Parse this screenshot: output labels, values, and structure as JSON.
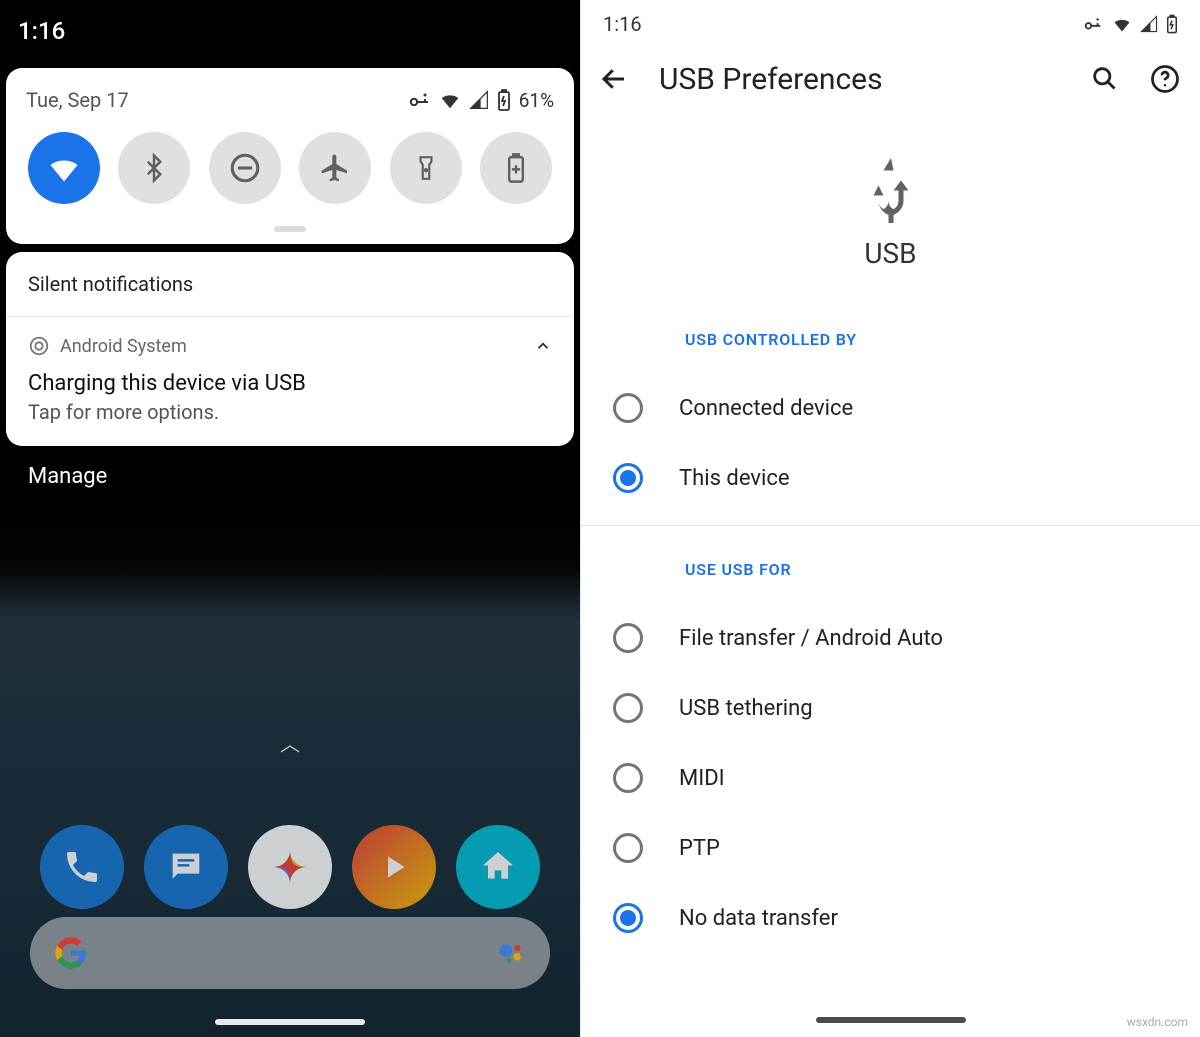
{
  "left": {
    "status": {
      "time": "1:16"
    },
    "qs": {
      "date": "Tue, Sep 17",
      "battery": "61%",
      "toggles": [
        {
          "name": "wifi",
          "active": true
        },
        {
          "name": "bluetooth",
          "active": false
        },
        {
          "name": "dnd",
          "active": false
        },
        {
          "name": "airplane",
          "active": false
        },
        {
          "name": "flashlight",
          "active": false
        },
        {
          "name": "battery-saver",
          "active": false
        }
      ]
    },
    "notifications": {
      "section_header": "Silent notifications",
      "item": {
        "source": "Android System",
        "title": "Charging this device via USB",
        "subtitle": "Tap for more options."
      }
    },
    "manage_label": "Manage"
  },
  "right": {
    "status": {
      "time": "1:16"
    },
    "title": "USB Preferences",
    "hero_label": "USB",
    "sections": {
      "controlled_by": {
        "header": "USB CONTROLLED BY",
        "options": [
          {
            "label": "Connected device",
            "checked": false
          },
          {
            "label": "This device",
            "checked": true
          }
        ]
      },
      "use_for": {
        "header": "USE USB FOR",
        "options": [
          {
            "label": "File transfer / Android Auto",
            "checked": false
          },
          {
            "label": "USB tethering",
            "checked": false
          },
          {
            "label": "MIDI",
            "checked": false
          },
          {
            "label": "PTP",
            "checked": false
          },
          {
            "label": "No data transfer",
            "checked": true
          }
        ]
      }
    }
  },
  "watermark": "wsxdn.com"
}
